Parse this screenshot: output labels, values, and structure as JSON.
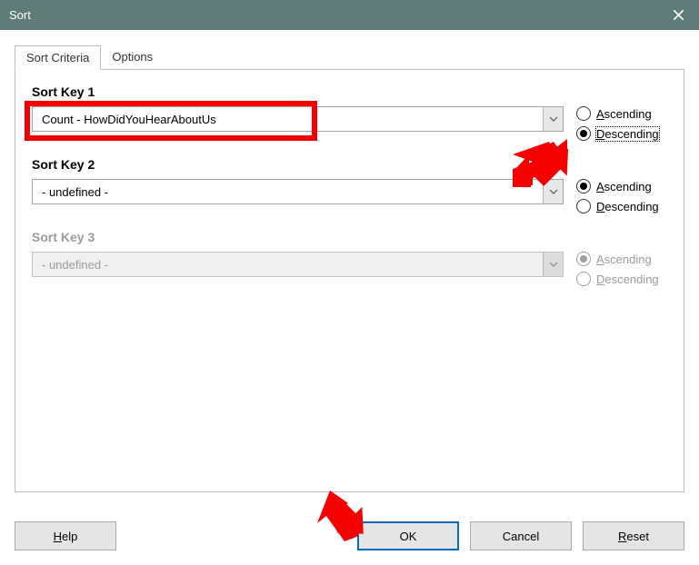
{
  "window": {
    "title": "Sort"
  },
  "tabs": {
    "criteria": "Sort Criteria",
    "options": "Options"
  },
  "labels": {
    "key1": "Sort Key 1",
    "key2": "Sort Key 2",
    "key3": "Sort Key 3",
    "ascending": "scending",
    "ascending_prefix": "A",
    "descending": "escending",
    "descending_prefix": "D"
  },
  "values": {
    "key1": "Count - HowDidYouHearAboutUs",
    "key2": "- undefined -",
    "key3": "- undefined -"
  },
  "buttons": {
    "help": "elp",
    "help_prefix": "H",
    "ok": "OK",
    "cancel": "Cancel",
    "reset": "eset",
    "reset_prefix": "R"
  }
}
